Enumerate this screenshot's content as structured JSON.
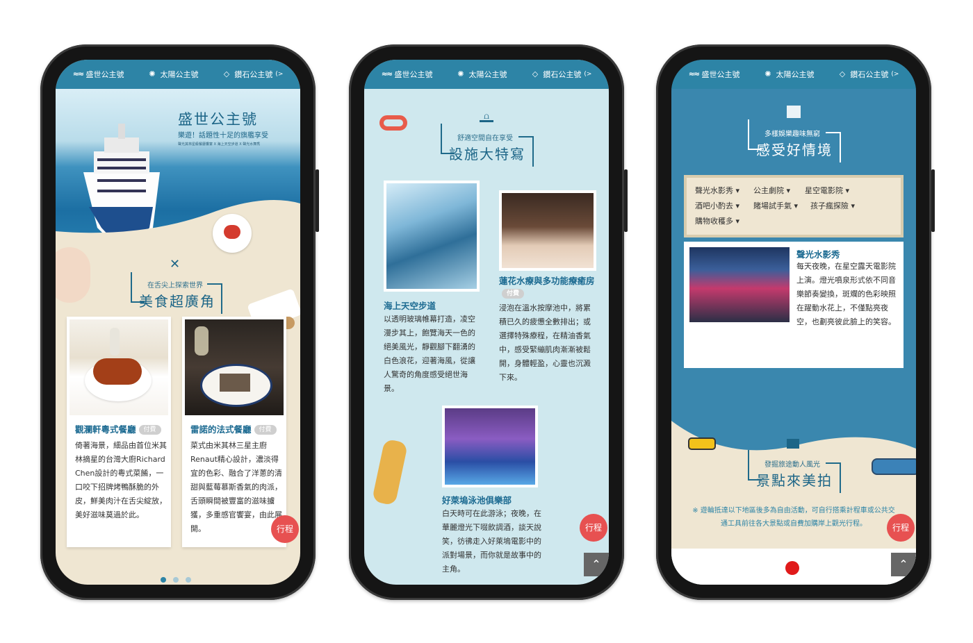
{
  "nav": {
    "item1": "盛世公主號",
    "item2": "太陽公主號",
    "item3": "鑽石公主號",
    "item3_suffix": "(>"
  },
  "phone1": {
    "hero_title": "盛世公主號",
    "hero_subtitle": "樂遊！話題性十足的旗艦享受",
    "hero_small": "聲光其林星級餐廳饗宴 X 海上天空步道 X 聲光水舞秀",
    "food_sub": "在舌尖上探索世界",
    "food_title": "美食超廣角",
    "card1_title": "觀瀾軒粵式餐廳",
    "card1_badge": "付費",
    "card1_text": "倚著海景，細品由首位米其林摘星的台灣大廚Richard Chen設計的粵式菜餚，一口咬下招牌烤鴨酥脆的外皮，鮮美肉汁在舌尖綻放，美好滋味莫過於此。",
    "card2_title": "雷諾的法式餐廳",
    "card2_badge": "付費",
    "card2_text": "菜式由米其林三星主廚Renaut精心設計，濃淡得宜的色彩、融合了洋蔥的清甜與藍莓慕斯香氣的肉派，舌頭瞬間被豐富的滋味擄獲，多重感官饗宴，由此展開。",
    "trip": "行程"
  },
  "phone2": {
    "sub": "舒適空間自在享受",
    "title": "設施大特寫",
    "item1_title": "海上天空步道",
    "item1_text": "以透明玻璃帷幕打造，凌空漫步其上，飽覽海天一色的絕美風光，靜觀腳下翻湧的白色浪花，迎著海風，從讓人驚奇的角度感受絕世海景。",
    "item2_title": "蓮花水療與多功能療癒房",
    "item2_badge": "付費",
    "item2_text": "浸泡在溫水按摩池中，將累積已久的疲憊全數排出；或選擇特殊療程，在精油香氣中，感受緊繃肌肉漸漸被鬆開，身體輕盈，心靈也沉澱下來。",
    "item3_title": "好萊塢泳池俱樂部",
    "item3_text": "白天時可在此游泳；夜晚，在華麗燈光下啜飲調酒，談天說笑，彷彿走入好萊塢電影中的派對場景，而你就是故事中的主角。",
    "trip": "行程",
    "up": "⌃"
  },
  "phone3": {
    "sub": "多樣娛樂趣味無窮",
    "title": "感受好情境",
    "dd1": "聲光水影秀",
    "dd2": "公主劇院",
    "dd3": "星空電影院",
    "dd4": "酒吧小酌去",
    "dd5": "賭場試手氣",
    "dd6": "孩子瘋探險",
    "dd7": "購物收穫多",
    "show_title": "聲光水影秀",
    "show_text": "每天夜晚，在星空露天電影院上演。燈光噴泉形式依不同音樂節奏變換，斑斕的色彩映照在躍動水花上，不僅點亮夜空，也劃亮彼此臉上的笑容。",
    "scenic_sub": "發掘旅途動人風光",
    "scenic_title": "景點來美拍",
    "note": "※ 遊輪抵達以下地區後多為自由活動，可自行搭乘計程車或公共交通工具前往各大景點或自費加購岸上觀光行程。",
    "trip": "行程",
    "up": "⌃"
  },
  "colors": {
    "nav": "#2d84a6",
    "accent": "#e75151",
    "sand": "#efe6d2"
  }
}
